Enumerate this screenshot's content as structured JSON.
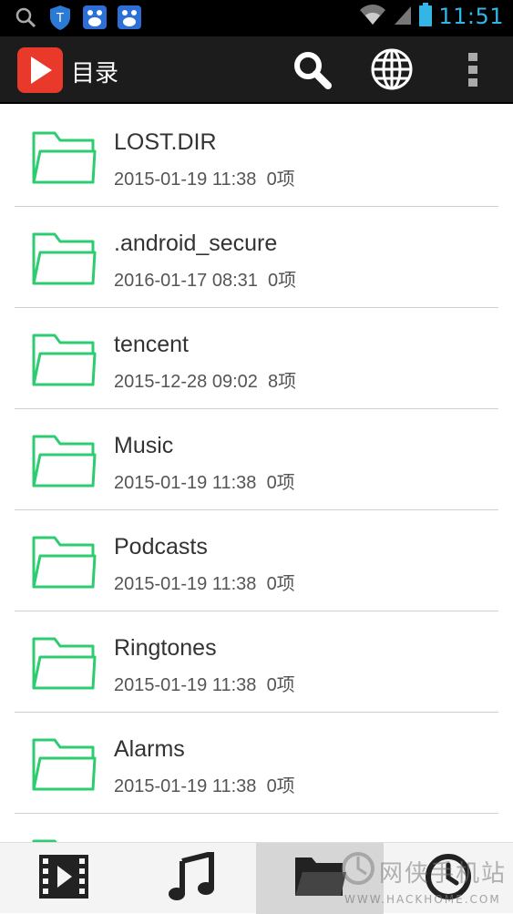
{
  "status_bar": {
    "time": "11:51",
    "icons": [
      "search-icon",
      "shield-icon",
      "baidu-icon",
      "baidu-icon",
      "wifi-icon",
      "signal-icon",
      "battery-icon"
    ],
    "accent_color": "#33b5e5"
  },
  "action_bar": {
    "title": "目录",
    "logo_color": "#e8392a",
    "actions": [
      "search-icon",
      "globe-icon",
      "overflow-menu-icon"
    ]
  },
  "folders": [
    {
      "name": "LOST.DIR",
      "date": "2015-01-19 11:38",
      "count": "0项"
    },
    {
      "name": ".android_secure",
      "date": "2016-01-17 08:31",
      "count": "0项"
    },
    {
      "name": "tencent",
      "date": "2015-12-28 09:02",
      "count": "8项"
    },
    {
      "name": "Music",
      "date": "2015-01-19 11:38",
      "count": "0项"
    },
    {
      "name": "Podcasts",
      "date": "2015-01-19 11:38",
      "count": "0项"
    },
    {
      "name": "Ringtones",
      "date": "2015-01-19 11:38",
      "count": "0项"
    },
    {
      "name": "Alarms",
      "date": "2015-01-19 11:38",
      "count": "0项"
    }
  ],
  "folder_color": "#2ecc71",
  "bottom_tabs": [
    {
      "icon": "video-icon",
      "active": false
    },
    {
      "icon": "music-icon",
      "active": false
    },
    {
      "icon": "folder-icon",
      "active": true
    },
    {
      "icon": "history-icon",
      "active": false
    }
  ],
  "watermark": {
    "text_cn": "网侠手机站",
    "text_en": "WWW.HACKHOME.COM"
  }
}
